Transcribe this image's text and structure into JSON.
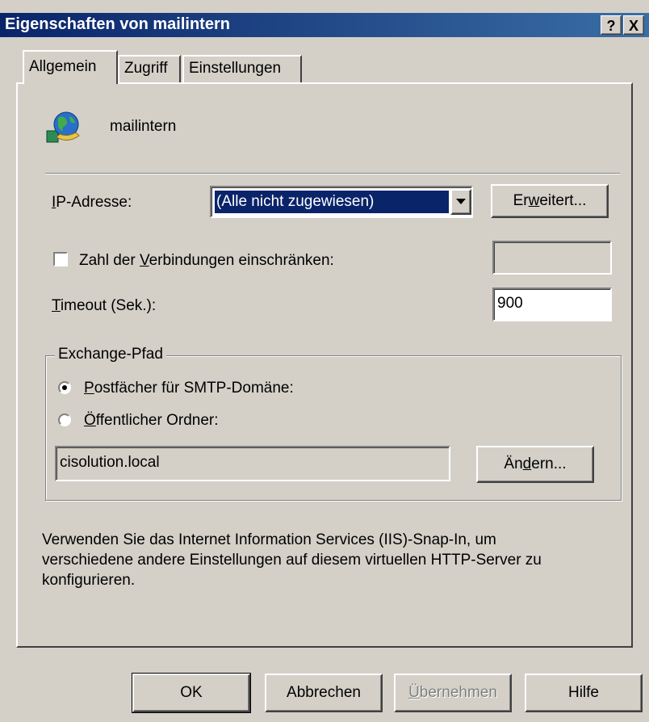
{
  "window": {
    "title": "Eigenschaften von mailintern",
    "help_button": "?",
    "close_button": "X"
  },
  "tabs": [
    {
      "label": "Allgemein",
      "active": true
    },
    {
      "label": "Zugriff",
      "active": false
    },
    {
      "label": "Einstellungen",
      "active": false
    }
  ],
  "general": {
    "server_name": "mailintern",
    "server_icon": "globe-server-icon",
    "ip_label_pre": "",
    "ip_label_mnemonic": "I",
    "ip_label_post": "P-Adresse:",
    "ip_value": "(Alle nicht zugewiesen)",
    "advanced_pre": "Er",
    "advanced_mnemonic": "w",
    "advanced_post": "eitert...",
    "limit_pre": "Zahl der ",
    "limit_mnemonic": "V",
    "limit_post": "erbindungen einschränken:",
    "limit_checked": false,
    "limit_value": "",
    "timeout_pre": "",
    "timeout_mnemonic": "T",
    "timeout_post": "imeout (Sek.):",
    "timeout_value": "900"
  },
  "exchange_path": {
    "legend": "Exchange-Pfad",
    "option1_mnemonic": "P",
    "option1_post": "ostfächer für SMTP-Domäne:",
    "option2_mnemonic": "Ö",
    "option2_post": "ffentlicher Ordner:",
    "selected": 1,
    "path_value": "cisolution.local",
    "change_pre": "Än",
    "change_mnemonic": "d",
    "change_post": "ern..."
  },
  "info_text_line1": "Verwenden Sie das Internet Information Services (IIS)-Snap-In, um",
  "info_text_line2": "verschiedene andere Einstellungen auf diesem virtuellen HTTP-Server zu",
  "info_text_line3": "konfigurieren.",
  "buttons": {
    "ok": "OK",
    "cancel": "Abbrechen",
    "apply_mnemonic": "Ü",
    "apply_post": "bernehmen",
    "help": "Hilfe"
  }
}
